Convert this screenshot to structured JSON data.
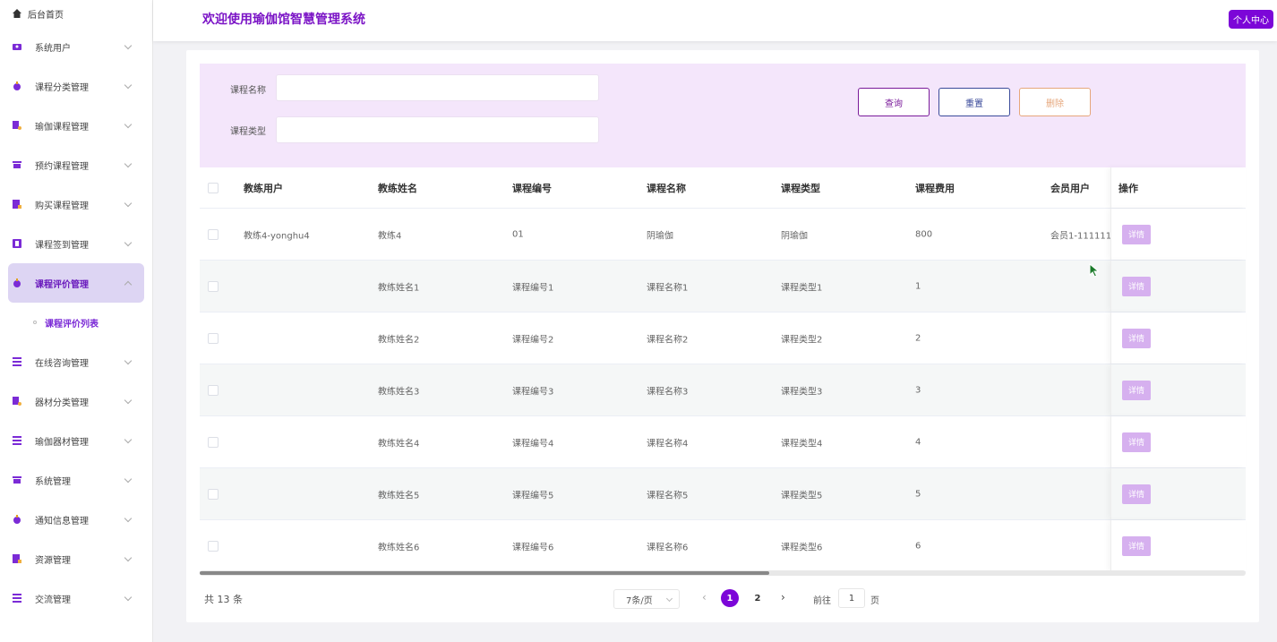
{
  "sidebar": {
    "home_label": "后台首页",
    "items": [
      {
        "label": "系统用户",
        "icon": "users-icon",
        "color": "#7b2bd6"
      },
      {
        "label": "课程分类管理",
        "icon": "drop-icon",
        "color": "#7b2bd6"
      },
      {
        "label": "瑜伽课程管理",
        "icon": "doc-icon",
        "color": "#7b2bd6"
      },
      {
        "label": "预约课程管理",
        "icon": "box-icon",
        "color": "#7b2bd6"
      },
      {
        "label": "购买课程管理",
        "icon": "edit-icon",
        "color": "#7b2bd6"
      },
      {
        "label": "课程签到管理",
        "icon": "book-icon",
        "color": "#7b2bd6"
      },
      {
        "label": "课程评价管理",
        "icon": "drop-icon",
        "color": "#7b2bd6"
      }
    ],
    "active_sub": "课程评价列表",
    "items_after": [
      {
        "label": "在线咨询管理",
        "icon": "list-icon"
      },
      {
        "label": "器材分类管理",
        "icon": "doc-icon"
      },
      {
        "label": "瑜伽器材管理",
        "icon": "list-icon"
      },
      {
        "label": "系统管理",
        "icon": "box-icon"
      },
      {
        "label": "通知信息管理",
        "icon": "drop-icon"
      },
      {
        "label": "资源管理",
        "icon": "edit-icon"
      },
      {
        "label": "交流管理",
        "icon": "list-icon"
      }
    ]
  },
  "header": {
    "title": "欢迎使用瑜伽馆智慧管理系统",
    "profile_label": "个人中心"
  },
  "search": {
    "course_name_label": "课程名称",
    "course_type_label": "课程类型",
    "search_btn": "查询",
    "reset_btn": "重置",
    "delete_btn": "删除"
  },
  "table": {
    "columns": [
      "教练用户",
      "教练姓名",
      "课程编号",
      "课程名称",
      "课程类型",
      "课程费用",
      "会员用户",
      "操作"
    ],
    "rows": [
      [
        "教练4-yonghu4",
        "教练4",
        "01",
        "阴瑜伽",
        "阴瑜伽",
        "800",
        "会员1-111111"
      ],
      [
        "",
        "教练姓名1",
        "课程编号1",
        "课程名称1",
        "课程类型1",
        "1",
        ""
      ],
      [
        "",
        "教练姓名2",
        "课程编号2",
        "课程名称2",
        "课程类型2",
        "2",
        ""
      ],
      [
        "",
        "教练姓名3",
        "课程编号3",
        "课程名称3",
        "课程类型3",
        "3",
        ""
      ],
      [
        "",
        "教练姓名4",
        "课程编号4",
        "课程名称4",
        "课程类型4",
        "4",
        ""
      ],
      [
        "",
        "教练姓名5",
        "课程编号5",
        "课程名称5",
        "课程类型5",
        "5",
        ""
      ],
      [
        "",
        "教练姓名6",
        "课程编号6",
        "课程名称6",
        "课程类型6",
        "6",
        ""
      ]
    ],
    "detail_label": "详情"
  },
  "pagination": {
    "total": "共 13 条",
    "page_size": "7条/页",
    "pages": [
      "1",
      "2"
    ],
    "goto_label": "前往",
    "goto_value": "1",
    "page_suffix": "页"
  },
  "colors": {
    "accent": "#7c06d8",
    "search_panel": "#f4e6fb",
    "active_menu": "#ddd5f3"
  }
}
